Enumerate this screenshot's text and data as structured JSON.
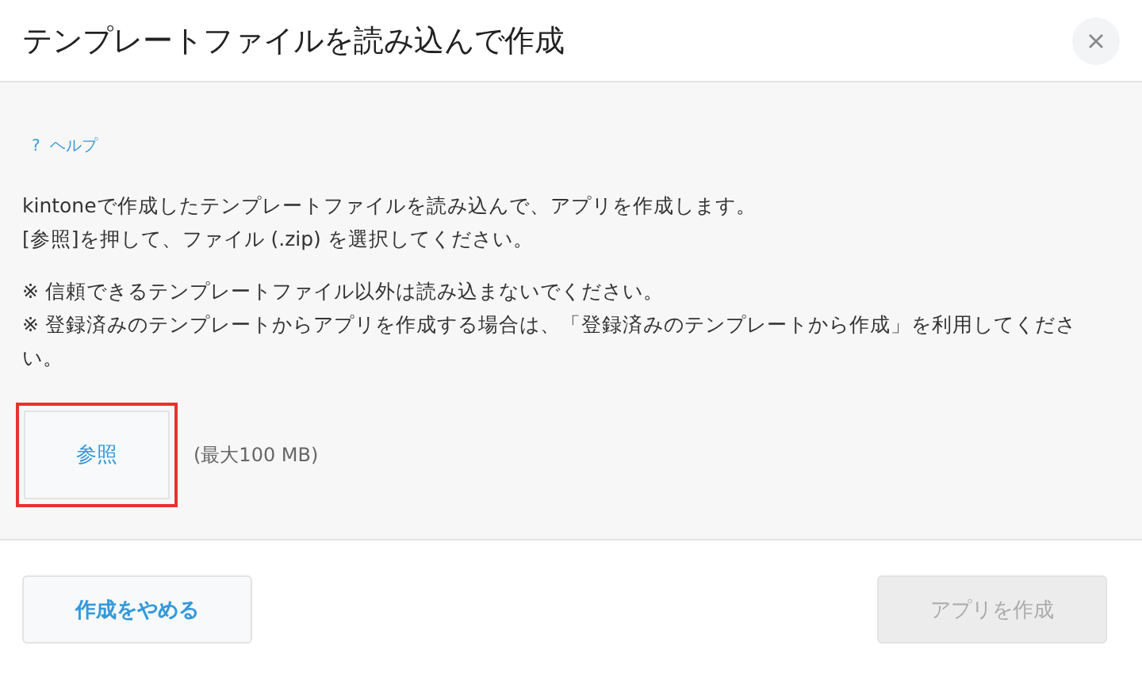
{
  "dialog": {
    "title": "テンプレートファイルを読み込んで作成"
  },
  "help": {
    "icon": "?",
    "label": "ヘルプ"
  },
  "description": [
    "kintoneで作成したテンプレートファイルを読み込んで、アプリを作成します。",
    "[参照]を押して、ファイル (.zip) を選択してください。"
  ],
  "notes": [
    "※ 信頼できるテンプレートファイル以外は読み込まないでください。",
    "※ 登録済みのテンプレートからアプリを作成する場合は、「登録済みのテンプレートから作成」を利用してください。"
  ],
  "browse": {
    "label": "参照",
    "highlighted": true,
    "limit": "(最大100 MB)"
  },
  "buttons": [
    {
      "label": "作成をやめる",
      "disabled": false
    },
    {
      "label": "アプリを作成",
      "disabled": true
    }
  ]
}
